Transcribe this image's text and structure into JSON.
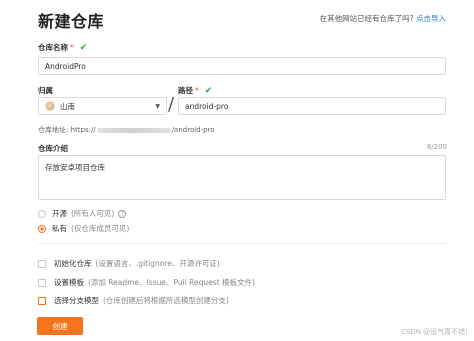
{
  "page": {
    "title": "新建仓库"
  },
  "import": {
    "prompt": "在其他网站已经有仓库了吗?",
    "link": "点击导入"
  },
  "repo_name": {
    "label": "仓库名称",
    "required_mark": "*",
    "value": "AndroidPro"
  },
  "owner": {
    "label": "归属",
    "value": "山南"
  },
  "path": {
    "label": "路径",
    "required_mark": "*",
    "separator": "/",
    "value": "android-pro"
  },
  "repo_url": {
    "prefix": "仓库地址: https://",
    "suffix": "/android-pro"
  },
  "description": {
    "label": "仓库介绍",
    "counter": "8/200",
    "value": "存放安卓项目仓库"
  },
  "visibility": {
    "public": {
      "label": "开源",
      "hint": "(所有人可见)",
      "selected": false
    },
    "private": {
      "label": "私有",
      "hint": "(仅仓库成员可见)",
      "selected": true
    }
  },
  "options": [
    {
      "label": "初始化仓库",
      "hint": "(设置语言、.gitignore、开源许可证)"
    },
    {
      "label": "设置模板",
      "hint": "(添加 Readme、Issue、Pull Request 模板文件)"
    },
    {
      "label": "选择分支模型",
      "hint": "(仓库创建后将根据所选模型创建分支)"
    }
  ],
  "submit": {
    "label": "创建"
  },
  "watermark": "CSDN @运气真不错!",
  "colors": {
    "accent": "#f3731e",
    "link": "#2f7bd3",
    "valid": "#27a844",
    "required": "#e84b3c"
  },
  "icons": {
    "valid": "check-icon",
    "dropdown": "chevron-down-icon",
    "help": "help-icon"
  }
}
